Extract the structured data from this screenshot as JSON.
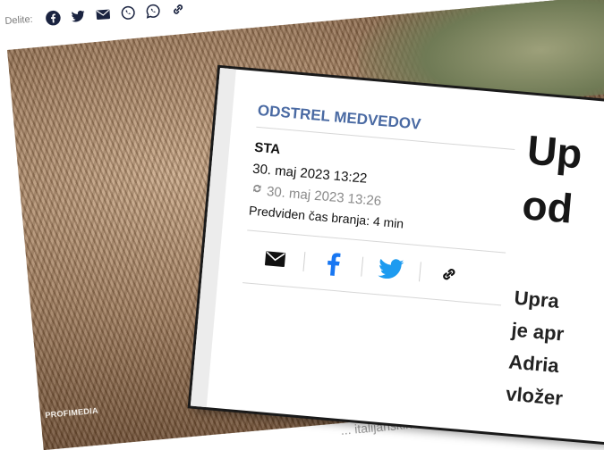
{
  "share_bar": {
    "label": "Delite:",
    "icons": [
      "facebook-icon",
      "twitter-icon",
      "mail-icon",
      "viber-icon",
      "whatsapp-icon",
      "link-icon"
    ]
  },
  "photo": {
    "credit": "PROFIMEDIA",
    "below_caption": "... italijanskih ..."
  },
  "article": {
    "category": "ODSTREL MEDVEDOV",
    "author": "STA",
    "date": "30. maj 2023 13:22",
    "updated": "30. maj 2023 13:26",
    "reading_time": "Predviden čas branja: 4 min",
    "headline_lines": [
      "Up",
      "od"
    ],
    "lead_lines": [
      "Upra",
      "je apr",
      "Adria",
      "vložer"
    ]
  },
  "colors": {
    "category": "#4a6aa3",
    "facebook": "#1877f2",
    "twitter": "#1d9bf0",
    "text": "#111111"
  }
}
